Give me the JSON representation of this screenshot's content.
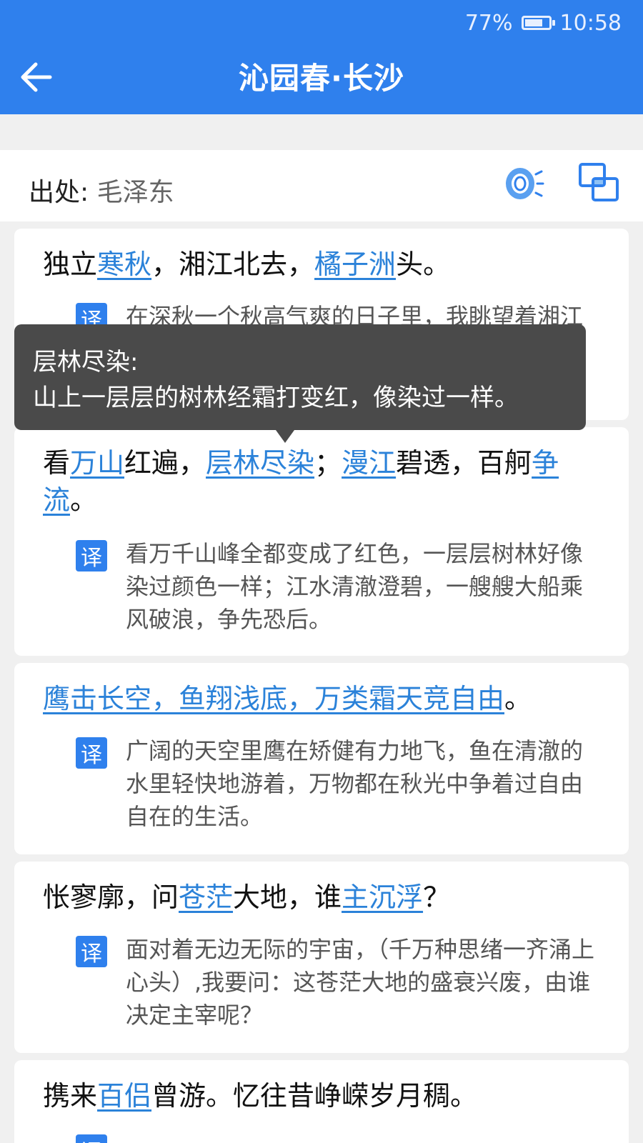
{
  "status_bar": {
    "battery": "77%",
    "battery_level": 0.77,
    "time": "10:58"
  },
  "header": {
    "title": "沁园春·长沙",
    "back_icon": "back-arrow-icon"
  },
  "source": {
    "label": "出处:",
    "value": "毛泽东",
    "audio_icon": "audio-icon",
    "copy_icon": "copy-icon"
  },
  "translate_badge": "译",
  "cards": [
    {
      "verse": {
        "p1": "独立",
        "l1": "寒秋",
        "p2": "，湘江北去，",
        "l2": "橘子洲",
        "p3": "头。"
      },
      "translation": "在深秋一个秋高气爽的日子里，我眺望着湘江碧水缓缓北流，独自伫立在橘子洲头。"
    },
    {
      "verse": {
        "p1": "看",
        "l1": "万山",
        "p2": "红遍，",
        "l2": "层林尽染",
        "p3": "；",
        "l3": "漫江",
        "p4": "碧透，百舸",
        "l4a": "争",
        "l4b": "流",
        "p5": "。"
      },
      "translation": "看万千山峰全都变成了红色，一层层树林好像染过颜色一样；江水清澈澄碧，一艘艘大船乘风破浪，争先恐后。"
    },
    {
      "verse": {
        "l1": "鹰击长空，鱼翔浅底，万类霜天竞自由",
        "p1": "。"
      },
      "translation": "广阔的天空里鹰在矫健有力地飞，鱼在清澈的水里轻快地游着，万物都在秋光中争着过自由自在的生活。"
    },
    {
      "verse": {
        "p1": "怅寥廓，问",
        "l1": "苍茫",
        "p2": "大地，谁",
        "l2": "主沉浮",
        "p3": "？"
      },
      "translation": "面对着无边无际的宇宙，（千万种思绪一齐涌上心头）,我要问：这苍茫大地的盛衰兴废，由谁决定主宰呢？"
    },
    {
      "verse": {
        "p1": "携来",
        "l1": "百侣",
        "p2": "曾游。忆往昔峥嵘岁月稠。"
      }
    }
  ],
  "tooltip": {
    "term": "层林尽染:",
    "explanation": "山上一层层的树林经霜打变红，像染过一样。"
  }
}
